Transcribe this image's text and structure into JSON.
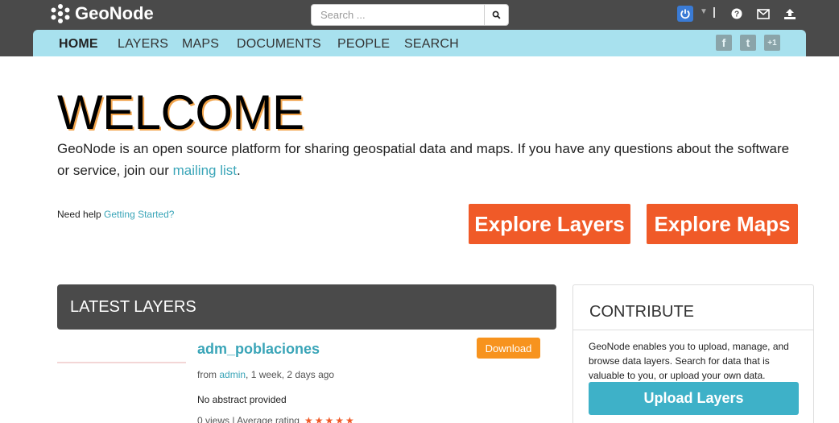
{
  "header": {
    "brand": "GeoNode",
    "search_placeholder": "Search ...",
    "icons": [
      "power-icon",
      "help-icon",
      "mail-icon",
      "upload-icon"
    ]
  },
  "nav": {
    "items": [
      "HOME",
      "LAYERS",
      "MAPS",
      "DOCUMENTS",
      "PEOPLE",
      "SEARCH"
    ],
    "social": [
      "f",
      "t",
      "+1"
    ]
  },
  "hero": {
    "title": "WELCOME",
    "intro_text": "GeoNode is an open source platform for sharing geospatial data and maps. If you have any questions about the software or service, join our ",
    "mailing_list": "mailing list",
    "period": ".",
    "help_text": "Need help ",
    "help_link": "Getting Started?",
    "explore_layers": "Explore Layers",
    "explore_maps": "Explore Maps"
  },
  "latest": {
    "heading": "LATEST LAYERS",
    "layer": {
      "title": "adm_poblaciones",
      "download": "Download",
      "from": "from ",
      "author": "admin",
      "time": ", 1 week, 2 days ago",
      "abstract": "No abstract provided",
      "rating_label": "0 views | Average rating",
      "stars": "★★★★★"
    }
  },
  "contribute": {
    "heading": "CONTRIBUTE",
    "text": "GeoNode enables you to upload, manage, and browse data layers. Search for data that is valuable to you, or upload your own data.",
    "button": "Upload Layers"
  },
  "colors": {
    "topbar": "#4a4a4a",
    "nav": "#a8e1ee",
    "accent_orange": "#f05a28",
    "download_orange": "#f7931e",
    "link_teal": "#3aa5b8",
    "upload_teal": "#3eb1c8"
  }
}
